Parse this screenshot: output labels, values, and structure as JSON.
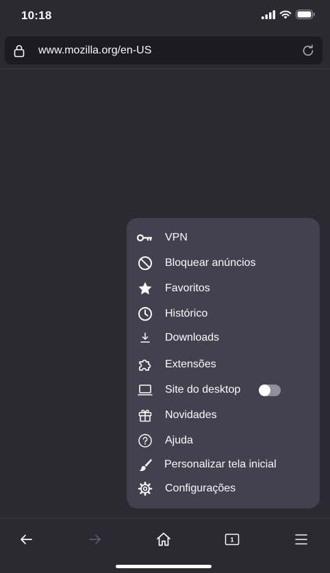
{
  "status_bar": {
    "time": "10:18",
    "icons": [
      "signal-icon",
      "wifi-icon",
      "battery-icon"
    ]
  },
  "url_bar": {
    "url": "www.mozilla.org/en-US",
    "icons": [
      "lock-icon",
      "reload-icon"
    ]
  },
  "menu": {
    "items": [
      {
        "label": "VPN",
        "icon": "key-icon"
      },
      {
        "label": "Bloquear anúncios",
        "icon": "block-icon"
      },
      {
        "label": "Favoritos",
        "icon": "star-icon"
      },
      {
        "label": "Histórico",
        "icon": "clock-icon"
      },
      {
        "label": "Downloads",
        "icon": "download-icon"
      },
      {
        "label": "Extensões",
        "icon": "puzzle-icon"
      },
      {
        "label": "Site do desktop",
        "icon": "laptop-icon",
        "toggle": false
      },
      {
        "label": "Novidades",
        "icon": "gift-icon"
      },
      {
        "label": "Ajuda",
        "icon": "help-icon"
      },
      {
        "label": "Personalizar tela inicial",
        "icon": "brush-icon"
      },
      {
        "label": "Configurações",
        "icon": "gear-icon"
      }
    ]
  },
  "toolbar": {
    "tab_count": "1",
    "buttons": [
      "back-icon",
      "forward-icon",
      "home-icon",
      "tabs-icon",
      "menu-icon"
    ]
  },
  "colors": {
    "background": "#2b2a33",
    "url_bar": "#1c1b22",
    "menu": "#42414d",
    "text": "#fbfbfe"
  }
}
